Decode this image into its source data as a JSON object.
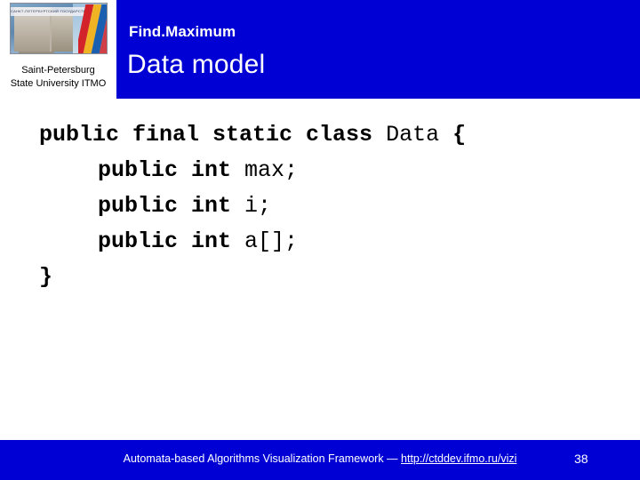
{
  "header": {
    "logo_alt": "ITMO university emblem",
    "logo_banner_text": "САНКТ-ПЕТЕРБУРГСКИЙ ГОСУДАРСТВЕННЫЙ УНИВЕРСИТЕТ",
    "logo_caption_line1": "Saint-Petersburg",
    "logo_caption_line2": "State University ITMO",
    "subtitle": "Find.Maximum",
    "title": "Data model",
    "band_color": "#0000d4"
  },
  "code": {
    "lines": [
      {
        "indent": 0,
        "bold": "public final static class ",
        "plain": "Data ",
        "tail": "{"
      },
      {
        "indent": 1,
        "bold": "public int ",
        "plain": "max;",
        "tail": ""
      },
      {
        "indent": 1,
        "bold": "public int ",
        "plain": "i;",
        "tail": ""
      },
      {
        "indent": 1,
        "bold": "public int ",
        "plain": "a[];",
        "tail": ""
      },
      {
        "indent": 0,
        "bold": "}",
        "plain": "",
        "tail": ""
      }
    ]
  },
  "footer": {
    "text_before_link": "Automata-based Algorithms Visualization Framework — ",
    "link": "http://ctddev.ifmo.ru/vizi",
    "page_number": "38",
    "band_color": "#0000d4"
  }
}
